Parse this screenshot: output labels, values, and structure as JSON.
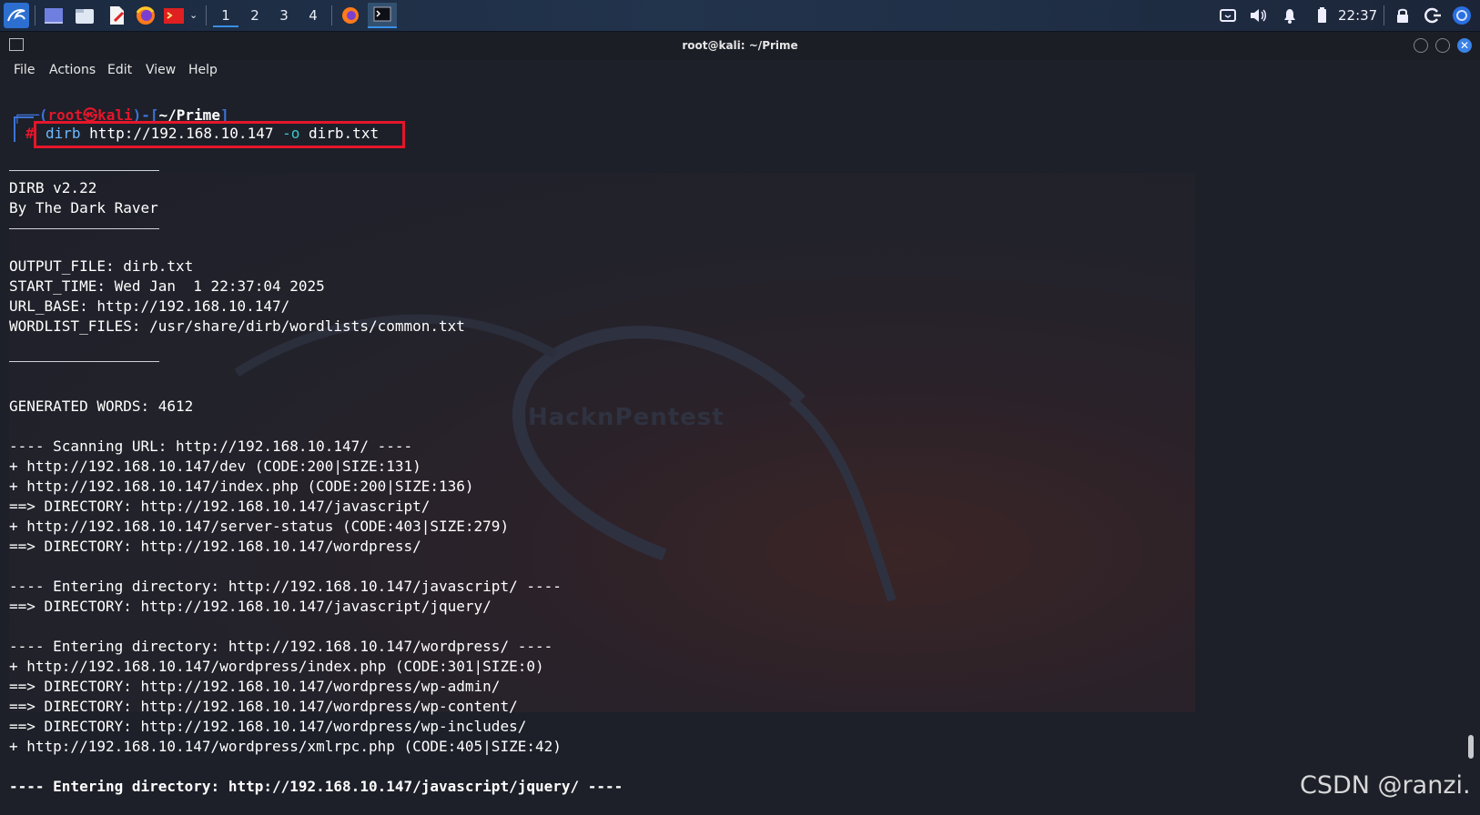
{
  "taskbar": {
    "workspaces": [
      "1",
      "2",
      "3",
      "4"
    ],
    "clock": "22:37"
  },
  "window": {
    "title": "root@kali: ~/Prime"
  },
  "menu": [
    "File",
    "Actions",
    "Edit",
    "View",
    "Help"
  ],
  "prompt": {
    "user": "root",
    "at": "㉿",
    "host": "kali",
    "path": "~/Prime",
    "command": "dirb",
    "url": "http://192.168.10.147",
    "flag": "-o",
    "outfile": "dirb.txt"
  },
  "output": {
    "banner_version": "DIRB v2.22",
    "banner_author": "By The Dark Raver",
    "output_file": "OUTPUT_FILE: dirb.txt",
    "start_time": "START_TIME: Wed Jan  1 22:37:04 2025",
    "url_base": "URL_BASE: http://192.168.10.147/",
    "wordlist": "WORDLIST_FILES: /usr/share/dirb/wordlists/common.txt",
    "generated": "GENERATED WORDS: 4612",
    "lines": [
      "---- Scanning URL: http://192.168.10.147/ ----",
      "+ http://192.168.10.147/dev (CODE:200|SIZE:131)",
      "+ http://192.168.10.147/index.php (CODE:200|SIZE:136)",
      "==> DIRECTORY: http://192.168.10.147/javascript/",
      "+ http://192.168.10.147/server-status (CODE:403|SIZE:279)",
      "==> DIRECTORY: http://192.168.10.147/wordpress/",
      "",
      "---- Entering directory: http://192.168.10.147/javascript/ ----",
      "==> DIRECTORY: http://192.168.10.147/javascript/jquery/",
      "",
      "---- Entering directory: http://192.168.10.147/wordpress/ ----",
      "+ http://192.168.10.147/wordpress/index.php (CODE:301|SIZE:0)",
      "==> DIRECTORY: http://192.168.10.147/wordpress/wp-admin/",
      "==> DIRECTORY: http://192.168.10.147/wordpress/wp-content/",
      "==> DIRECTORY: http://192.168.10.147/wordpress/wp-includes/",
      "+ http://192.168.10.147/wordpress/xmlrpc.php (CODE:405|SIZE:42)",
      "",
      "---- Entering directory: http://192.168.10.147/javascript/jquery/ ----"
    ]
  },
  "watermark": {
    "wallpaper_text": "HacknPentest",
    "csdn": "CSDN @ranzi."
  },
  "colors": {
    "prompt_red": "#e4162a",
    "prompt_blue": "#3c72d6",
    "command_cyan": "#6fb8ff",
    "flag_cyan": "#3ec7c9",
    "highlight_box": "#e4162a"
  }
}
